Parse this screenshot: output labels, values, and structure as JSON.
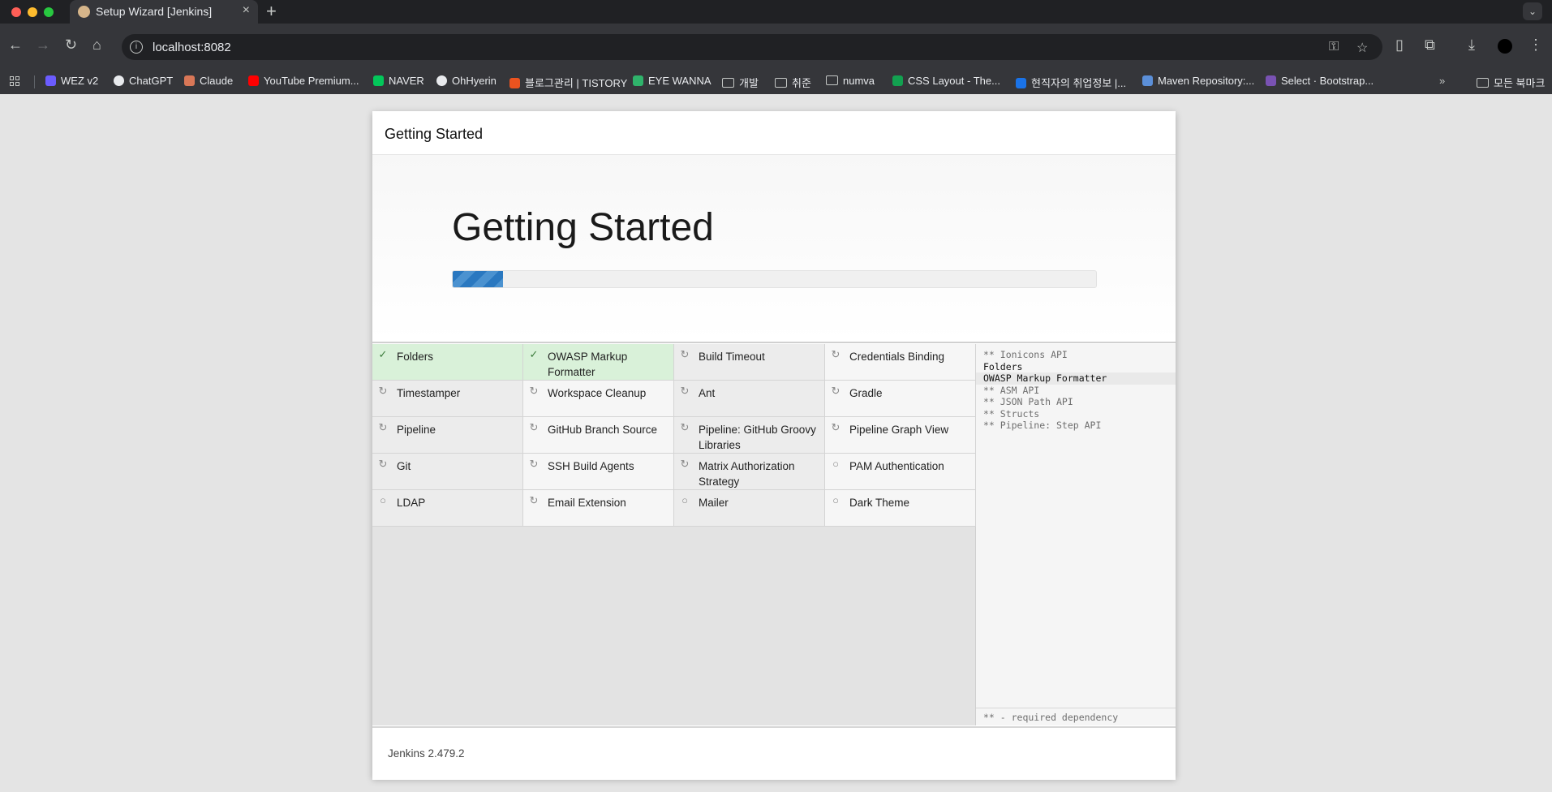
{
  "browser": {
    "tab_title": "Setup Wizard [Jenkins]",
    "url": "localhost:8082",
    "new_tab_symbol": "+",
    "close_symbol": "×",
    "bookmarks": [
      {
        "label": "WEZ v2",
        "icon": "wez-icon",
        "color": "#6b5cff"
      },
      {
        "label": "ChatGPT",
        "icon": "chatgpt-icon",
        "color": "#e8eaed"
      },
      {
        "label": "Claude",
        "icon": "claude-icon",
        "color": "#d97757"
      },
      {
        "label": "YouTube Premium...",
        "icon": "youtube-icon",
        "color": "#ff0000"
      },
      {
        "label": "NAVER",
        "icon": "naver-icon",
        "color": "#03c75a"
      },
      {
        "label": "OhHyerin",
        "icon": "github-icon",
        "color": "#e8eaed"
      },
      {
        "label": "블로그관리 | TISTORY",
        "icon": "tistory-icon",
        "color": "#eb531f"
      },
      {
        "label": "EYE WANNA",
        "icon": "eyewanna-icon",
        "color": "#2fb36b"
      },
      {
        "label": "개발",
        "icon": "folder-icon",
        "color": "#c4c7c5"
      },
      {
        "label": "취준",
        "icon": "folder-icon",
        "color": "#c4c7c5"
      },
      {
        "label": "numva",
        "icon": "folder-icon",
        "color": "#c4c7c5"
      },
      {
        "label": "CSS Layout - The...",
        "icon": "csslayout-icon",
        "color": "#12a150"
      },
      {
        "label": "현직자의 취업정보 |...",
        "icon": "job-icon",
        "color": "#1a73e8"
      },
      {
        "label": "Maven Repository:...",
        "icon": "maven-icon",
        "color": "#5b8fd8"
      },
      {
        "label": "Select · Bootstrap...",
        "icon": "bootstrap-icon",
        "color": "#7952b3"
      }
    ],
    "all_bookmarks_label": "모든 북마크",
    "more_symbol": "»"
  },
  "dialog": {
    "header_title": "Getting Started",
    "hero_title": "Getting Started",
    "progress_fraction": 0.078,
    "plugins": [
      {
        "name": "Folders",
        "status": "success",
        "symbol": "✓"
      },
      {
        "name": "OWASP Markup Formatter",
        "status": "success",
        "symbol": "✓"
      },
      {
        "name": "Build Timeout",
        "status": "installing",
        "symbol": "↻"
      },
      {
        "name": "Credentials Binding",
        "status": "pending",
        "symbol": "↻"
      },
      {
        "name": "Timestamper",
        "status": "installing",
        "symbol": "↻"
      },
      {
        "name": "Workspace Cleanup",
        "status": "pending",
        "symbol": "↻"
      },
      {
        "name": "Ant",
        "status": "pending",
        "symbol": "↻"
      },
      {
        "name": "Gradle",
        "status": "pending",
        "symbol": "↻"
      },
      {
        "name": "Pipeline",
        "status": "pending",
        "symbol": "↻"
      },
      {
        "name": "GitHub Branch Source",
        "status": "pending",
        "symbol": "↻"
      },
      {
        "name": "Pipeline: GitHub Groovy Libraries",
        "status": "pending",
        "symbol": "↻"
      },
      {
        "name": "Pipeline Graph View",
        "status": "pending",
        "symbol": "↻"
      },
      {
        "name": "Git",
        "status": "installing",
        "symbol": "↻"
      },
      {
        "name": "SSH Build Agents",
        "status": "pending",
        "symbol": "↻"
      },
      {
        "name": "Matrix Authorization Strategy",
        "status": "pending",
        "symbol": "↻"
      },
      {
        "name": "PAM Authentication",
        "status": "pending",
        "symbol": "○"
      },
      {
        "name": "LDAP",
        "status": "pending",
        "symbol": "○"
      },
      {
        "name": "Email Extension",
        "status": "pending",
        "symbol": "↻"
      },
      {
        "name": "Mailer",
        "status": "pending",
        "symbol": "○"
      },
      {
        "name": "Dark Theme",
        "status": "pending",
        "symbol": "○"
      }
    ],
    "log_lines": [
      {
        "text": "** Ionicons API",
        "kind": "dep"
      },
      {
        "text": "Folders",
        "kind": "cur"
      },
      {
        "text": "OWASP Markup Formatter",
        "kind": "cur",
        "highlight": true
      },
      {
        "text": "** ASM API",
        "kind": "dep"
      },
      {
        "text": "** JSON Path API",
        "kind": "dep"
      },
      {
        "text": "** Structs",
        "kind": "dep"
      },
      {
        "text": "** Pipeline: Step API",
        "kind": "dep"
      }
    ],
    "log_legend": "** - required dependency",
    "footer_version": "Jenkins 2.479.2"
  }
}
